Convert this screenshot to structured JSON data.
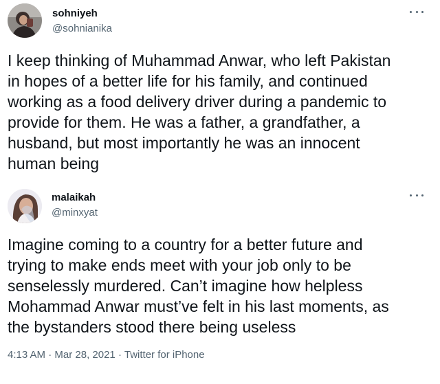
{
  "tweets": [
    {
      "author_name": "sohniyeh",
      "handle": "@sohnianika",
      "avatar": "person-photo",
      "more_icon": "more-horizontal-icon",
      "text": "I keep thinking of Muhammad Anwar, who left Pakistan\nin hopes of a better life for his family, and continued\nworking as a food delivery driver during a pandemic to\nprovide for them. He was a father, a grandfather, a\nhusband, but most importantly he was an innocent\nhuman being"
    },
    {
      "author_name": "malaikah",
      "handle": "@minxyat",
      "avatar": "person-photo",
      "more_icon": "more-horizontal-icon",
      "text": "Imagine coming to a country for a better future and\ntrying to make ends meet with your job only to be\nsenselessly murdered. Can’t imagine how helpless\nMohammad Anwar must’ve felt in his last moments, as\nthe bystanders stood there being useless",
      "time": "4:13 AM",
      "separator": "·",
      "date": "Mar 28, 2021",
      "source": "Twitter for iPhone"
    }
  ],
  "colors": {
    "text_primary": "#0f1419",
    "text_secondary": "#536471"
  }
}
